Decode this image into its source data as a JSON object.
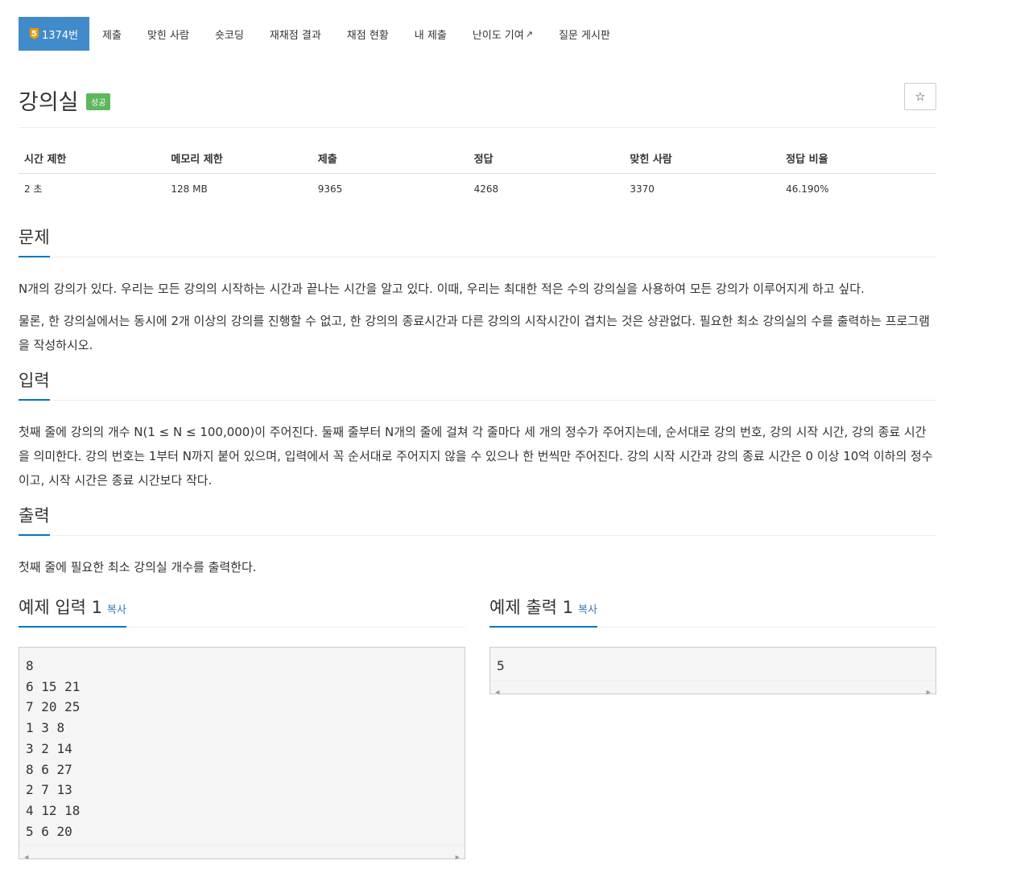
{
  "tabs": [
    {
      "label": "1374번",
      "tier": "5"
    },
    {
      "label": "제출"
    },
    {
      "label": "맞힌 사람"
    },
    {
      "label": "숏코딩"
    },
    {
      "label": "재채점 결과"
    },
    {
      "label": "채점 현황"
    },
    {
      "label": "내 제출"
    },
    {
      "label": "난이도 기여"
    },
    {
      "label": "질문 게시판"
    }
  ],
  "problem": {
    "title": "강의실",
    "badge": "성공",
    "star_icon": "☆"
  },
  "stats": {
    "headers": [
      "시간 제한",
      "메모리 제한",
      "제출",
      "정답",
      "맞힌 사람",
      "정답 비율"
    ],
    "values": [
      "2 초",
      "128 MB",
      "9365",
      "4268",
      "3370",
      "46.190%"
    ]
  },
  "sections": {
    "description": {
      "title": "문제",
      "p1": "N개의 강의가 있다. 우리는 모든 강의의 시작하는 시간과 끝나는 시간을 알고 있다. 이때, 우리는 최대한 적은 수의 강의실을 사용하여 모든 강의가 이루어지게 하고 싶다.",
      "p2": "물론, 한 강의실에서는 동시에 2개 이상의 강의를 진행할 수 없고, 한 강의의 종료시간과 다른 강의의 시작시간이 겹치는 것은 상관없다. 필요한 최소 강의실의 수를 출력하는 프로그램을 작성하시오."
    },
    "input": {
      "title": "입력",
      "p1": "첫째 줄에 강의의 개수 N(1 ≤ N ≤ 100,000)이 주어진다. 둘째 줄부터 N개의 줄에 걸쳐 각 줄마다 세 개의 정수가 주어지는데, 순서대로 강의 번호, 강의 시작 시간, 강의 종료 시간을 의미한다. 강의 번호는 1부터 N까지 붙어 있으며, 입력에서 꼭 순서대로 주어지지 않을 수 있으나 한 번씩만 주어진다. 강의 시작 시간과 강의 종료 시간은 0 이상 10억 이하의 정수이고, 시작 시간은 종료 시간보다 작다."
    },
    "output": {
      "title": "출력",
      "p1": "첫째 줄에 필요한 최소 강의실 개수를 출력한다."
    }
  },
  "samples": {
    "input": {
      "title": "예제 입력 1",
      "copy": "복사",
      "content": "8\n6 15 21\n7 20 25\n1 3 8\n3 2 14\n8 6 27\n2 7 13\n4 12 18\n5 6 20"
    },
    "output": {
      "title": "예제 출력 1",
      "copy": "복사",
      "content": "5"
    }
  }
}
